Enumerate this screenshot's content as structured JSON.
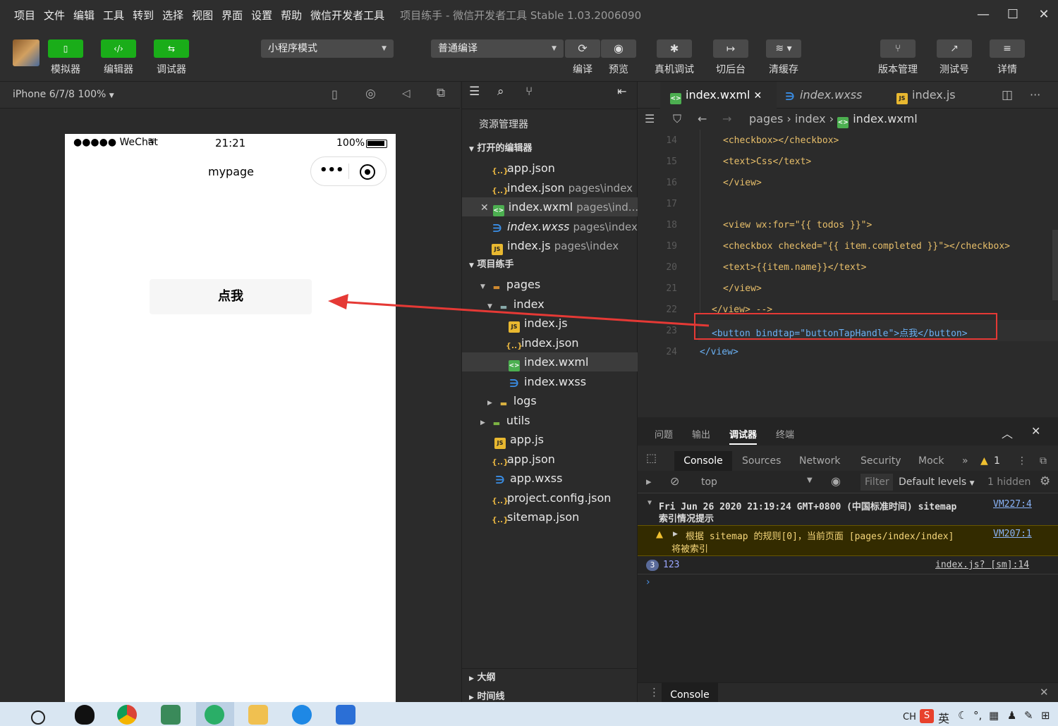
{
  "menubar": {
    "items": [
      "项目",
      "文件",
      "编辑",
      "工具",
      "转到",
      "选择",
      "视图",
      "界面",
      "设置",
      "帮助",
      "微信开发者工具"
    ],
    "title": "项目练手 - 微信开发者工具 Stable 1.03.2006090"
  },
  "toolbar": {
    "simulator": "模拟器",
    "editor": "编辑器",
    "debugger": "调试器",
    "mode_select": "小程序模式",
    "compile_select": "普通编译",
    "compile": "编译",
    "preview": "预览",
    "real_debug": "真机调试",
    "background": "切后台",
    "clear_cache": "清缓存",
    "version": "版本管理",
    "test": "测试号",
    "details": "详情"
  },
  "simulator": {
    "device": "iPhone 6/7/8 100%",
    "status_left": "●●●●● WeChat",
    "status_time": "21:21",
    "status_battery": "100%",
    "page_title": "mypage",
    "button_label": "点我"
  },
  "explorer": {
    "title": "资源管理器",
    "open_editors": "打开的编辑器",
    "open_files": [
      {
        "name": "app.json",
        "path": "",
        "icon": "json"
      },
      {
        "name": "index.json",
        "path": "pages\\index",
        "icon": "json"
      },
      {
        "name": "index.wxml",
        "path": "pages\\ind...",
        "icon": "wxml"
      },
      {
        "name": "index.wxss",
        "path": "pages\\index",
        "icon": "wxss"
      },
      {
        "name": "index.js",
        "path": "pages\\index",
        "icon": "js"
      }
    ],
    "project": "项目练手",
    "tree": [
      {
        "name": "pages",
        "icon": "folder"
      },
      {
        "name": "index",
        "icon": "folder"
      },
      {
        "name": "index.js",
        "icon": "js"
      },
      {
        "name": "index.json",
        "icon": "json"
      },
      {
        "name": "index.wxml",
        "icon": "wxml"
      },
      {
        "name": "index.wxss",
        "icon": "wxss"
      },
      {
        "name": "logs",
        "icon": "folder"
      },
      {
        "name": "utils",
        "icon": "folder"
      },
      {
        "name": "app.js",
        "icon": "js"
      },
      {
        "name": "app.json",
        "icon": "json"
      },
      {
        "name": "app.wxss",
        "icon": "wxss"
      },
      {
        "name": "project.config.json",
        "icon": "json"
      },
      {
        "name": "sitemap.json",
        "icon": "json"
      }
    ],
    "outline": "大纲",
    "timeline": "时间线"
  },
  "editor": {
    "tabs": [
      "index.wxml",
      "index.wxss",
      "index.js"
    ],
    "breadcrumb": [
      "pages",
      "index",
      "index.wxml"
    ],
    "lines": [
      {
        "n": "14",
        "text": "<checkbox></checkbox>"
      },
      {
        "n": "15",
        "text": "<text>Css</text>"
      },
      {
        "n": "16",
        "text": "</view>"
      },
      {
        "n": "17",
        "text": ""
      },
      {
        "n": "18",
        "text": "<view wx:for=\"{{ todos }}\">"
      },
      {
        "n": "19",
        "text": "<checkbox checked=\"{{ item.completed }}\"></checkbox>"
      },
      {
        "n": "20",
        "text": "<text>{{item.name}}</text>"
      },
      {
        "n": "21",
        "text": "</view>"
      },
      {
        "n": "22",
        "text": "</view> -->"
      },
      {
        "n": "23",
        "text": "<button bindtap=\"buttonTapHandle\">点我</button>"
      },
      {
        "n": "24",
        "text": "</view>"
      }
    ]
  },
  "debug": {
    "panel_tabs": [
      "问题",
      "输出",
      "调试器",
      "终端"
    ],
    "console_tabs": [
      "Console",
      "Sources",
      "Network",
      "Security",
      "Mock"
    ],
    "warn_count": "1",
    "context": "top",
    "filter_placeholder": "Filter",
    "levels": "Default levels",
    "hidden": "1 hidden",
    "log1_text": "Fri Jun 26 2020 21:19:24 GMT+0800 (中国标准时间) sitemap",
    "log1_text2": "索引情况提示",
    "log1_src": "VM227:4",
    "log2_text": "根据 sitemap 的规则[0]，当前页面 [pages/index/index]",
    "log2_text2": "将被索引",
    "log2_src": "VM207:1",
    "log3_count": "3",
    "log3_text": "123",
    "log3_src": "index.js? [sm]:14",
    "drawer_tab": "Console"
  },
  "taskbar": {
    "lang": "CH",
    "ime": "英"
  },
  "colors": {
    "accent_green": "#1aad19",
    "annotation_red": "#e53935"
  }
}
